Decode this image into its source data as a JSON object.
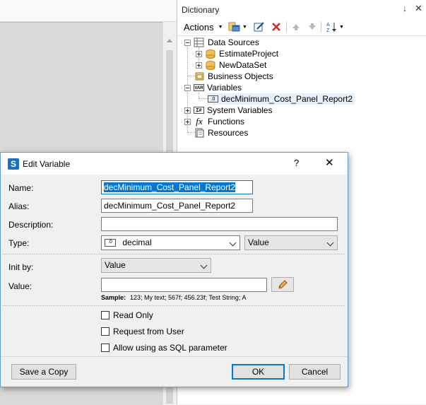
{
  "dictionary": {
    "title": "Dictionary",
    "pin_glyph": "↓",
    "close_glyph": "✕",
    "toolbar": {
      "actions_label": "Actions",
      "icons": [
        "new-item-icon",
        "edit-icon",
        "delete-icon",
        "move-up-icon",
        "move-down-icon",
        "sort-icon"
      ]
    },
    "tree": {
      "data_sources": "Data Sources",
      "estimate_project": "EstimateProject",
      "new_data_set": "NewDataSet",
      "business_objects": "Business Objects",
      "variables": "Variables",
      "var_item": "decMinimum_Cost_Panel_Report2",
      "system_variables": "System Variables",
      "functions": "Functions",
      "resources": "Resources",
      "var_icon_text": "VAR",
      "sysvar_icon_text": "Σ#",
      "fx_icon_text": "fx"
    }
  },
  "dialog": {
    "title": "Edit Variable",
    "help_glyph": "?",
    "close_glyph": "✕",
    "logo_letter": "S",
    "name_label": "Name:",
    "name_value": "decMinimum_Cost_Panel_Report2",
    "alias_label": "Alias:",
    "alias_value": "decMinimum_Cost_Panel_Report2",
    "description_label": "Description:",
    "description_value": "",
    "type_label": "Type:",
    "type_value": "decimal",
    "type_icon_text": ".0",
    "type_kind_value": "Value",
    "init_by_label": "Init by:",
    "init_by_value": "Value",
    "value_label": "Value:",
    "value_value": "",
    "sample_label": "Sample:",
    "sample_text": "123; My text; 567f; 456.23f; Test String; A",
    "read_only_label": "Read Only",
    "request_from_user_label": "Request from User",
    "allow_sql_label": "Allow using as SQL parameter",
    "save_copy_label": "Save a Copy",
    "ok_label": "OK",
    "cancel_label": "Cancel"
  },
  "colors": {
    "accent": "#0078d7",
    "dialog_border": "#5b9bd5",
    "delete_red": "#d9261c"
  }
}
